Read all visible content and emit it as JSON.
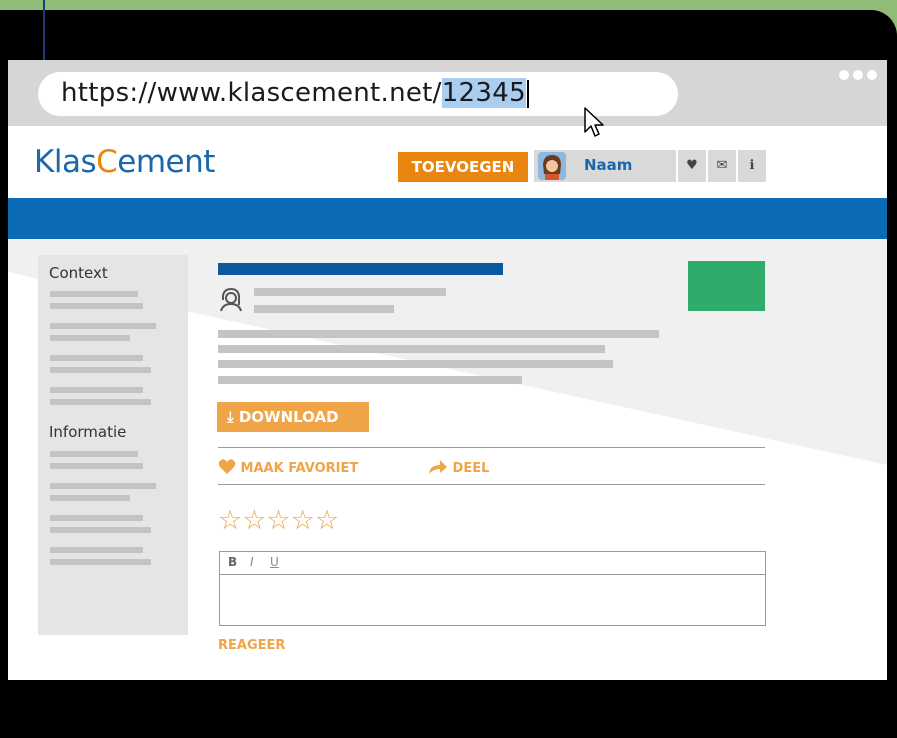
{
  "browser": {
    "url_prefix": "https://www.klascement.net/",
    "url_selected": "12345",
    "menu_dots": "●●●"
  },
  "header": {
    "logo_k": "K",
    "logo_las": "las",
    "logo_c": "C",
    "logo_ement": "ement",
    "add_button": "TOEVOEGEN",
    "user_name": "Naam",
    "icons": [
      "heart-icon",
      "mail-icon",
      "info-icon"
    ],
    "icon_glyphs": [
      "♥",
      "✉",
      "ℹ"
    ]
  },
  "sidebar": {
    "section1": "Context",
    "section2": "Informatie"
  },
  "content": {
    "download_button": "⤓ DOWNLOAD",
    "favorite": "MAAK FAVORIET",
    "share": "DEEL",
    "stars": "☆☆☆☆☆",
    "editor_bold": "B",
    "editor_italic": "I",
    "editor_underline": "U",
    "reply": "REAGEER"
  },
  "colors": {
    "brand_blue": "#0b6bb5",
    "brand_orange": "#e8860f",
    "accent_green": "#2fab6c"
  }
}
